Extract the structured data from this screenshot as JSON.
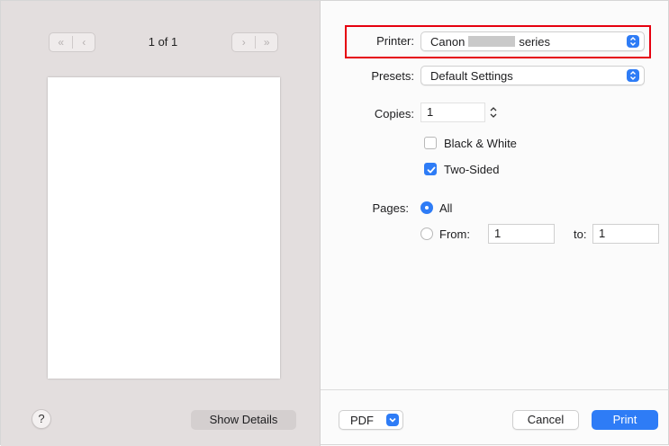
{
  "preview": {
    "prev_label": "≪ | ‹",
    "next_label": "› | ≫",
    "page_indicator": "1 of 1",
    "help_label": "?",
    "show_details_label": "Show Details"
  },
  "settings": {
    "printer": {
      "label": "Printer:",
      "value_prefix": "Canon",
      "value_suffix": "series"
    },
    "presets": {
      "label": "Presets:",
      "value": "Default Settings"
    },
    "copies": {
      "label": "Copies:",
      "value": "1"
    },
    "black_white": {
      "label": "Black & White",
      "checked": false
    },
    "two_sided": {
      "label": "Two-Sided",
      "checked": true
    },
    "pages": {
      "label": "Pages:",
      "all_label": "All",
      "from_label": "From:",
      "from_value": "1",
      "to_label": "to:",
      "to_value": "1",
      "selected": "All"
    }
  },
  "footer": {
    "pdf_label": "PDF",
    "cancel_label": "Cancel",
    "print_label": "Print"
  },
  "colors": {
    "accent": "#2e7cf6",
    "highlight": "#e6000f",
    "preview_bg": "#e3dede"
  }
}
